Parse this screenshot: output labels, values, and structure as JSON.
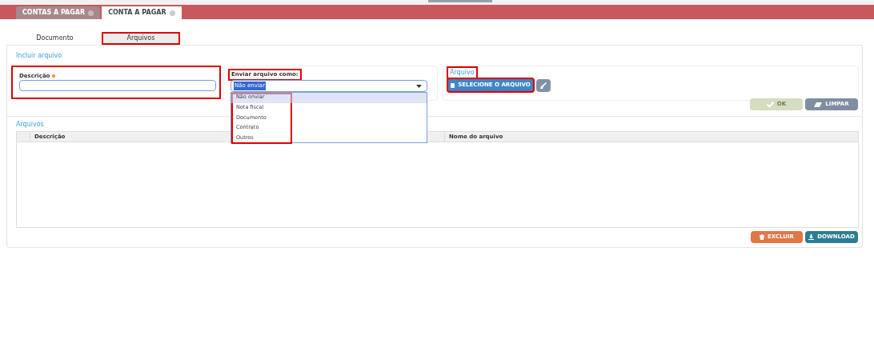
{
  "app_tabs": [
    {
      "label": "CONTAS A PAGAR",
      "selected": false
    },
    {
      "label": "CONTA A PAGAR",
      "selected": true
    }
  ],
  "tabs": [
    {
      "label": "Documento",
      "selected": false,
      "highlighted": false
    },
    {
      "label": "Arquivos",
      "selected": true,
      "highlighted": true
    }
  ],
  "include_section": {
    "title": "Incluir arquivo",
    "description": {
      "label": "Descrição",
      "required": true,
      "highlighted": true
    },
    "send_as": {
      "label": "Enviar arquivo como:",
      "label_highlighted": true,
      "value": "Não enviar",
      "expanded": true,
      "options_highlighted": true,
      "options": [
        {
          "label": "Não enviar",
          "selected": true
        },
        {
          "label": "Nota fiscal",
          "selected": false
        },
        {
          "label": "Documento",
          "selected": false
        },
        {
          "label": "Contrato",
          "selected": false
        },
        {
          "label": "Outros",
          "selected": false
        }
      ]
    },
    "file": {
      "label": "Arquivo",
      "label_highlighted": true,
      "select_button": "SELECIONE O ARQUIVO",
      "button_highlighted": true
    },
    "buttons": [
      {
        "label": "OK",
        "kind": "ok",
        "disabled": true
      },
      {
        "label": "LIMPAR",
        "kind": "clear",
        "disabled": false
      }
    ]
  },
  "files": {
    "title": "Arquivos",
    "columns": [
      "Descrição",
      "Nome do arquivo"
    ],
    "buttons": [
      {
        "label": "EXCLUIR",
        "kind": "delete"
      },
      {
        "label": "DOWNLOAD",
        "kind": "download"
      }
    ]
  }
}
